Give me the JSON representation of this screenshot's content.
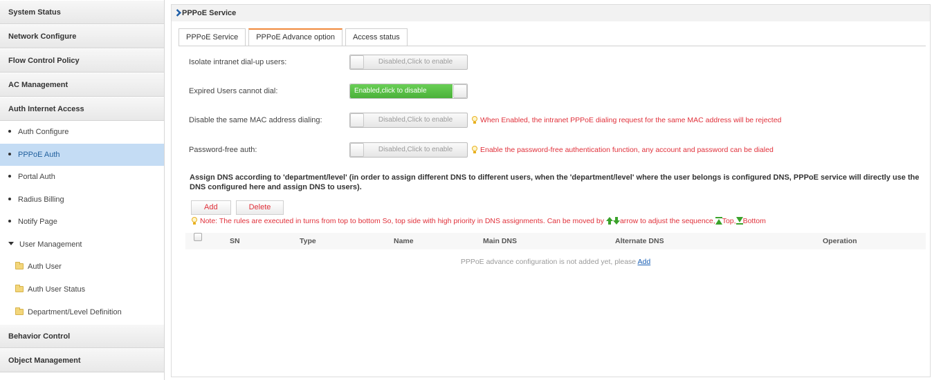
{
  "sidebar": {
    "items": [
      {
        "label": "System Status"
      },
      {
        "label": "Network Configure"
      },
      {
        "label": "Flow Control Policy"
      },
      {
        "label": "AC Management"
      },
      {
        "label": "Auth Internet Access"
      },
      {
        "label": "Auth Configure"
      },
      {
        "label": "PPPoE Auth"
      },
      {
        "label": "Portal Auth"
      },
      {
        "label": "Radius Billing"
      },
      {
        "label": "Notify Page"
      },
      {
        "label": "User Management"
      },
      {
        "label": "Auth User"
      },
      {
        "label": "Auth User Status"
      },
      {
        "label": "Department/Level Definition"
      },
      {
        "label": "Behavior Control"
      },
      {
        "label": "Object Management"
      }
    ]
  },
  "main": {
    "title": "PPPoE Service",
    "tabs": [
      {
        "label": "PPPoE Service"
      },
      {
        "label": "PPPoE Advance option"
      },
      {
        "label": "Access status"
      }
    ],
    "settings": [
      {
        "label": "Isolate intranet dial-up users:",
        "toggle": "Disabled,Click to enable",
        "hint": ""
      },
      {
        "label": "Expired Users cannot dial:",
        "toggle": "Enabled,click to disable",
        "hint": ""
      },
      {
        "label": "Disable the same MAC address dialing:",
        "toggle": "Disabled,Click to enable",
        "hint": "When Enabled, the intranet PPPoE dialing request for the same MAC address will be rejected"
      },
      {
        "label": "Password-free auth:",
        "toggle": "Disabled,Click to enable",
        "hint": "Enable the password-free authentication function, any account and password can be dialed"
      }
    ],
    "dns_description": "Assign DNS according to 'department/level' (in order to assign different DNS to different users, when the 'department/level' where the user belongs is configured DNS, PPPoE service will directly use the DNS configured here and assign DNS to users).",
    "buttons": {
      "add": "Add",
      "delete": "Delete"
    },
    "note": {
      "part1": "Note: The rules are executed in turns from top to bottom So, top side with high priority in DNS assignments. Can be moved by",
      "part2": "arrow to adjust the sequence,",
      "top": "Top,",
      "bottom": "Bottom"
    },
    "table": {
      "columns": [
        "SN",
        "Type",
        "Name",
        "Main DNS",
        "Alternate DNS",
        "Operation"
      ],
      "empty_text": "PPPoE advance configuration is not added yet, please",
      "empty_link": "Add"
    }
  },
  "colors": {
    "accent_tab": "#f0883a",
    "enabled_green": "#4bb13a",
    "hint_red": "#e0303a",
    "active_menu": "#c4dcf4"
  }
}
